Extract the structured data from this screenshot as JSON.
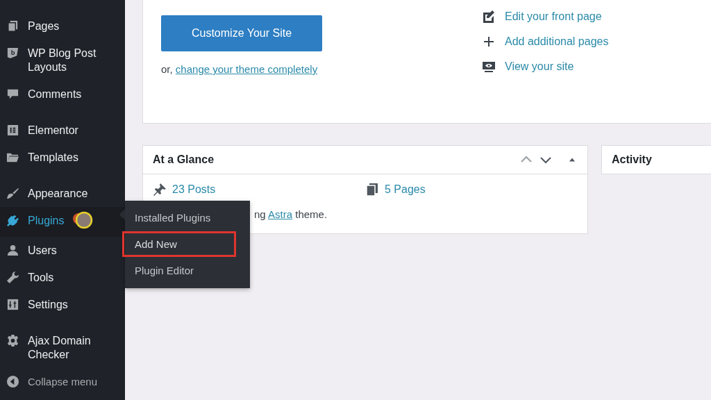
{
  "sidebar": {
    "groups": [
      [
        {
          "label": "Pages",
          "kind": "pages",
          "selected": false
        },
        {
          "label": "WP Blog Post Layouts",
          "kind": "b",
          "selected": false
        },
        {
          "label": "Comments",
          "kind": "comments",
          "selected": false
        }
      ],
      [
        {
          "label": "Elementor",
          "kind": "elementor",
          "selected": false
        },
        {
          "label": "Templates",
          "kind": "folder",
          "selected": false
        }
      ],
      [
        {
          "label": "Appearance",
          "kind": "brush",
          "selected": false
        },
        {
          "label": "Plugins",
          "kind": "plug",
          "selected": true
        },
        {
          "label": "Users",
          "kind": "user",
          "selected": false
        },
        {
          "label": "Tools",
          "kind": "wrench",
          "selected": false
        },
        {
          "label": "Settings",
          "kind": "settings",
          "selected": false
        }
      ],
      [
        {
          "label": "Ajax Domain Checker",
          "kind": "gear",
          "selected": false
        }
      ]
    ],
    "collapse": "Collapse menu"
  },
  "flyout": [
    {
      "label": "Installed Plugins",
      "highlighted": false
    },
    {
      "label": "Add New",
      "highlighted": true
    },
    {
      "label": "Plugin Editor",
      "highlighted": false
    }
  ],
  "welcome": {
    "button": "Customize Your Site",
    "alt_prefix": "or, ",
    "alt_link": "change your theme completely",
    "links": [
      {
        "label": "Edit your front page",
        "kind": "edit"
      },
      {
        "label": "Add additional pages",
        "kind": "plus"
      },
      {
        "label": "View your site",
        "kind": "view"
      }
    ]
  },
  "glance": {
    "title": "At a Glance",
    "posts": "23 Posts",
    "pages": "5 Pages",
    "theme_before": "ng ",
    "theme_link": "Astra",
    "theme_after": " theme."
  },
  "activity": {
    "title": "Activity"
  }
}
